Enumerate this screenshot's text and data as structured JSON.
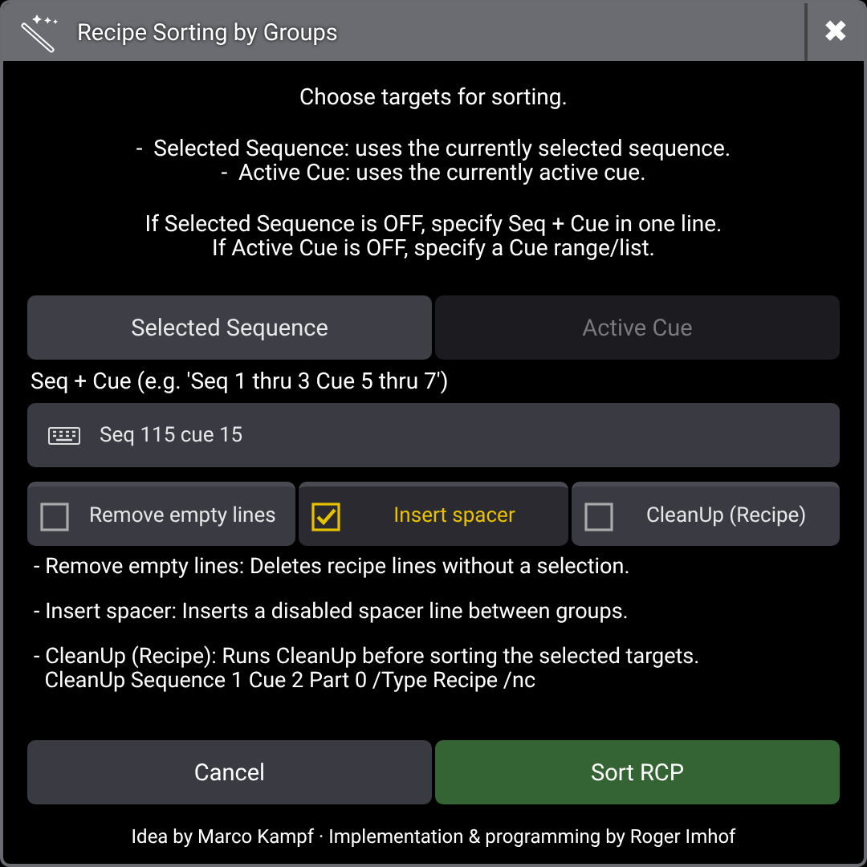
{
  "window": {
    "title": "Recipe Sorting by Groups",
    "close": "✖"
  },
  "intro": [
    [
      "Choose targets for sorting."
    ],
    [
      "-  Selected Sequence: uses the currently selected sequence.",
      "-  Active Cue: uses the currently active cue."
    ],
    [
      "If Selected Sequence is OFF, specify Seq + Cue in one line.",
      "If Active Cue is OFF, specify a Cue range/list."
    ]
  ],
  "tabs": [
    {
      "label": "Selected Sequence",
      "selected": true
    },
    {
      "label": "Active Cue",
      "selected": false
    }
  ],
  "field": {
    "label": "Seq + Cue (e.g. 'Seq 1 thru 3 Cue 5 thru 7')",
    "value": "Seq 115 cue 15"
  },
  "options": [
    {
      "label": "Remove empty lines",
      "checked": false
    },
    {
      "label": "Insert spacer",
      "checked": true
    },
    {
      "label": "CleanUp (Recipe)",
      "checked": false
    }
  ],
  "notes": [
    [
      "- Remove empty lines: Deletes recipe lines without a selection."
    ],
    [
      "- Insert spacer: Inserts a disabled spacer line between groups."
    ],
    [
      "- CleanUp (Recipe): Runs CleanUp before sorting the selected targets.",
      "  CleanUp Sequence 1 Cue 2 Part 0 /Type Recipe /nc"
    ]
  ],
  "buttons": [
    {
      "label": "Cancel",
      "kind": "neutral"
    },
    {
      "label": "Sort RCP",
      "kind": "primary"
    }
  ],
  "footer": "Idea by Marco Kampf · Implementation & programming by Roger Imhof"
}
